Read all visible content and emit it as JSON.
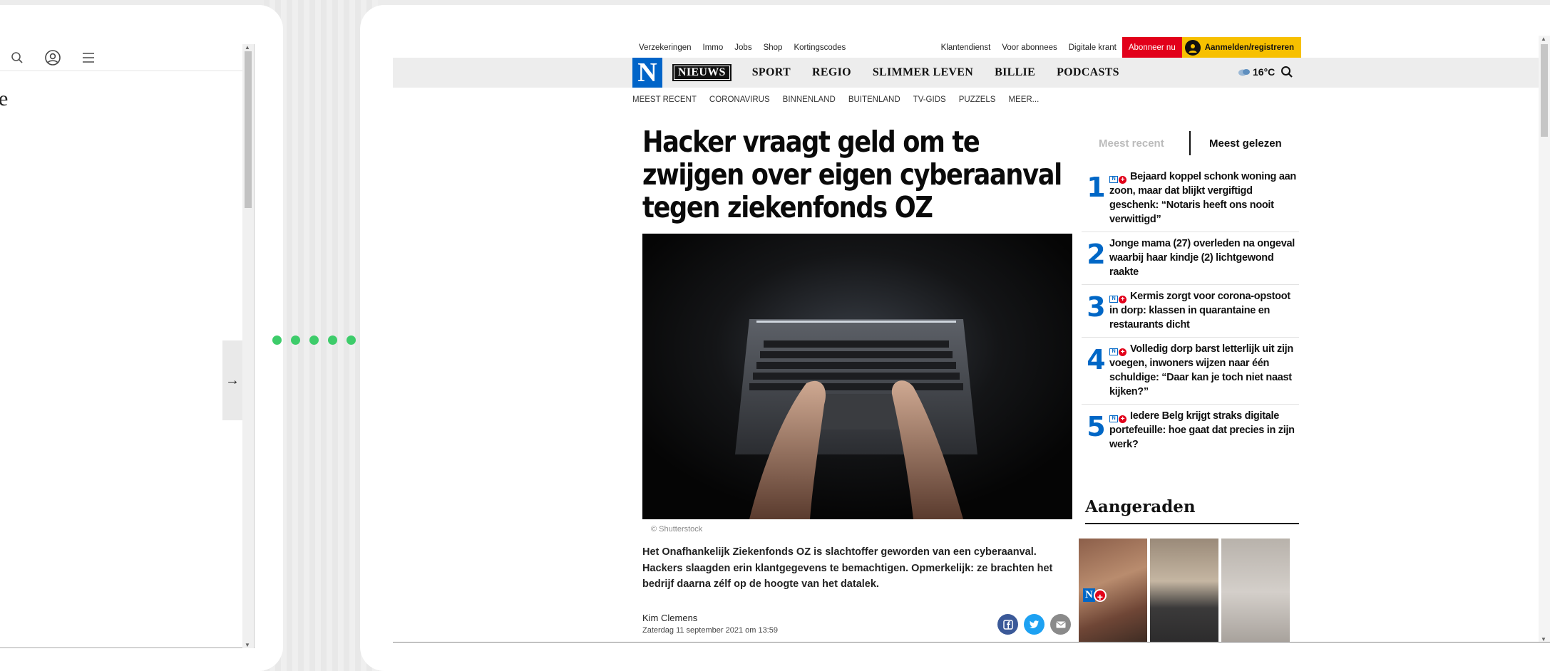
{
  "left_panel": {
    "partial_text": "e",
    "next_arrow": "→"
  },
  "utility_bar": {
    "left_links": [
      "Verzekeringen",
      "Immo",
      "Jobs",
      "Shop",
      "Kortingscodes"
    ],
    "right_links": [
      "Klantendienst",
      "Voor abonnees",
      "Digitale krant"
    ],
    "subscribe": "Abonneer nu",
    "login": "Aanmelden/registreren"
  },
  "nav": {
    "logo": "N",
    "items": [
      "NIEUWS",
      "SPORT",
      "REGIO",
      "SLIMMER LEVEN",
      "BILLIE",
      "PODCASTS"
    ],
    "weather": "16°C"
  },
  "subnav": [
    "MEEST RECENT",
    "CORONAVIRUS",
    "BINNENLAND",
    "BUITENLAND",
    "TV-GIDS",
    "PUZZELS",
    "MEER..."
  ],
  "article": {
    "headline": "Hacker vraagt geld om te zwijgen over eigen cyberaanval tegen ziekenfonds OZ",
    "image_credit": "© Shutterstock",
    "intro": "Het Onafhankelijk Ziekenfonds OZ is slachtoffer geworden van een cyberaanval. Hackers slaagden erin klantgegevens te bemachtigen. Opmerkelijk: ze brachten het bedrijf daarna zélf op de hoogte van het datalek.",
    "author": "Kim Clemens",
    "date": "Zaterdag 11 september 2021 om 13:59"
  },
  "sidebar": {
    "tab_recent": "Meest recent",
    "tab_read": "Meest gelezen",
    "items": [
      {
        "rank": "1",
        "premium": true,
        "title": "Bejaard koppel schonk woning aan zoon, maar dat blijkt vergiftigd geschenk: “Notaris heeft ons nooit verwittigd”"
      },
      {
        "rank": "2",
        "premium": false,
        "title": "Jonge mama (27) overleden na ongeval waarbij haar kindje (2) lichtgewond raakte"
      },
      {
        "rank": "3",
        "premium": true,
        "title": "Kermis zorgt voor corona-opstoot in dorp: klassen in quarantaine en restaurants dicht"
      },
      {
        "rank": "4",
        "premium": true,
        "title": "Volledig dorp barst letterlijk uit zijn voegen, inwoners wijzen naar één schuldige: “Daar kan je toch niet naast kijken?”"
      },
      {
        "rank": "5",
        "premium": true,
        "title": "Iedere Belg krijgt straks digitale portefeuille: hoe gaat dat precies in zijn werk?"
      }
    ],
    "aangeraden": "Aangeraden",
    "premium_badge_n": "N",
    "premium_badge_plus": "+"
  },
  "colors": {
    "brand_blue": "#0067c6",
    "subscribe_red": "#e2001a",
    "login_yellow": "#f7c000",
    "dots_green": "#3dcc6a"
  }
}
